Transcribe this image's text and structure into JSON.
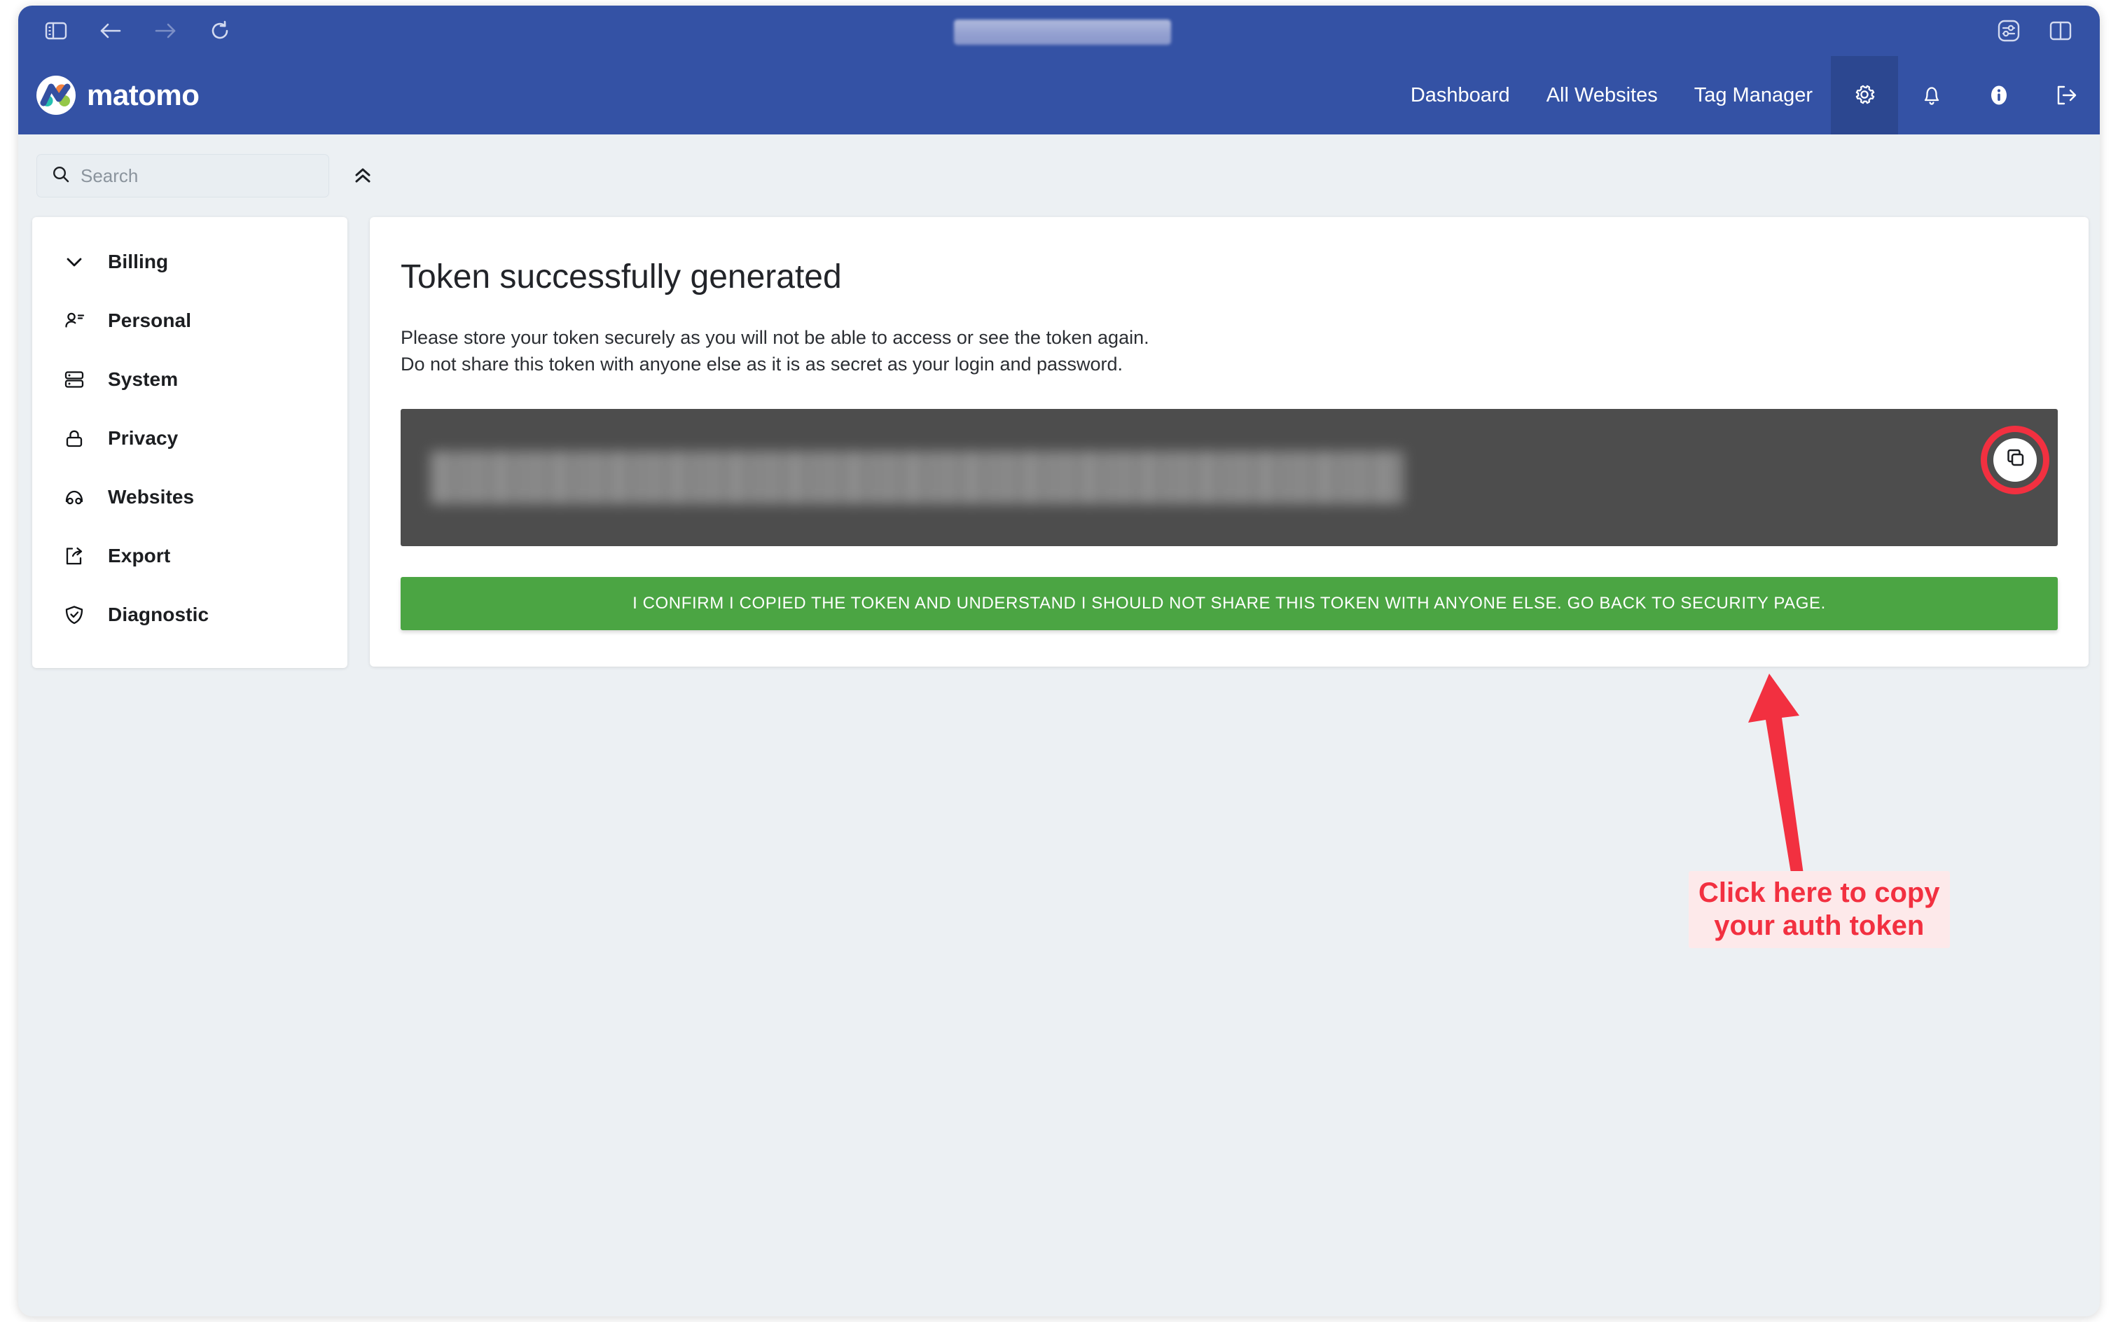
{
  "browser": {
    "toolbar_icons": [
      {
        "name": "sidebar-toggle-icon",
        "label": "Toggle Sidebar"
      },
      {
        "name": "back-icon",
        "label": "Back"
      },
      {
        "name": "forward-icon",
        "label": "Forward"
      },
      {
        "name": "reload-icon",
        "label": "Reload"
      }
    ],
    "url_value": "",
    "right_icons": [
      {
        "name": "page-settings-icon",
        "label": "Page Settings"
      },
      {
        "name": "split-view-icon",
        "label": "Split View"
      }
    ]
  },
  "header": {
    "brand": "matomo",
    "nav": [
      {
        "label": "Dashboard"
      },
      {
        "label": "All Websites"
      },
      {
        "label": "Tag Manager"
      }
    ],
    "icons": [
      {
        "name": "gear-icon",
        "label": "Administration",
        "active": true
      },
      {
        "name": "bell-icon",
        "label": "Notifications",
        "active": false
      },
      {
        "name": "info-icon",
        "label": "Help",
        "active": false
      },
      {
        "name": "logout-icon",
        "label": "Sign out",
        "active": false
      }
    ],
    "brand_color": "#3452A5",
    "brand_active_color": "#2C4790"
  },
  "search": {
    "placeholder": "Search",
    "value": "",
    "icon": "search-icon",
    "collapse_icon": "chevrons-up-icon"
  },
  "sidebar": {
    "items": [
      {
        "label": "Billing",
        "icon": "chevron-down-icon"
      },
      {
        "label": "Personal",
        "icon": "user-list-icon"
      },
      {
        "label": "System",
        "icon": "server-icon"
      },
      {
        "label": "Privacy",
        "icon": "lock-icon"
      },
      {
        "label": "Websites",
        "icon": "globe-arc-icon"
      },
      {
        "label": "Export",
        "icon": "export-icon"
      },
      {
        "label": "Diagnostic",
        "icon": "shield-check-icon"
      }
    ]
  },
  "main": {
    "title": "Token successfully generated",
    "paragraph_line_1": "Please store your token securely as you will not be able to access or see the token again.",
    "paragraph_line_2": "Do not share this token with anyone else as it is as secret as your login and password.",
    "token_value": "",
    "copy_button": {
      "name": "copy-token-button",
      "icon": "copy-icon"
    },
    "confirm_button_label": "I CONFIRM I COPIED THE TOKEN AND UNDERSTAND I SHOULD NOT SHARE THIS TOKEN WITH ANYONE ELSE. GO BACK TO SECURITY PAGE.",
    "confirm_button_color": "#4BA543",
    "token_box_color": "#4D4D4D"
  },
  "annotation": {
    "text": "Click here to copy\nyour auth token",
    "color": "#F23040",
    "background": "#FDE9EA"
  },
  "colors": {
    "page_background": "#ECF0F3",
    "card_background": "#FFFFFF",
    "text": "#222429"
  }
}
